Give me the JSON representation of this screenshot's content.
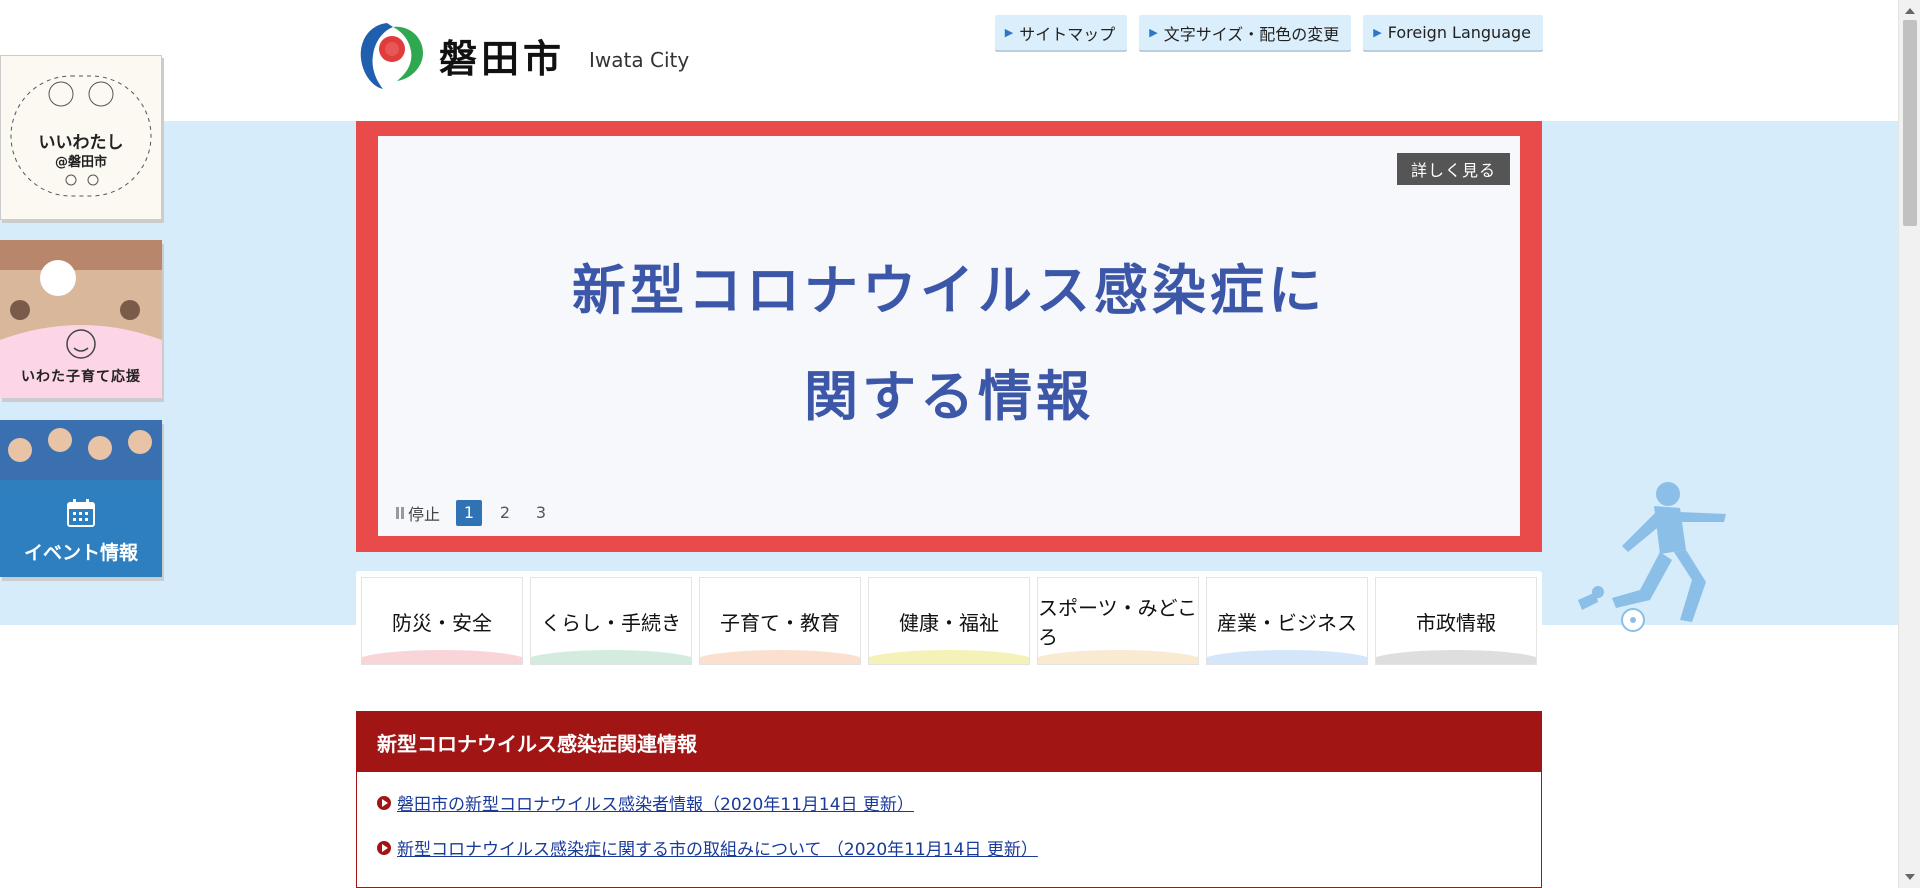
{
  "header": {
    "logo_name": "磐田市",
    "logo_en": "Iwata City",
    "top_links": [
      "サイトマップ",
      "文字サイズ・配色の変更",
      "Foreign Language"
    ]
  },
  "side_banners": [
    {
      "line1": "いいわたし",
      "line2": "@磐田市"
    },
    {
      "line1": "いわた子育て応援"
    },
    {
      "line1": "イベント情報"
    }
  ],
  "slider": {
    "detail_label": "詳しく見る",
    "title_line1": "新型コロナウイルス感染症に",
    "title_line2": "関する情報",
    "pause_label": "停止",
    "pages": [
      "1",
      "2",
      "3"
    ],
    "active_page": "1"
  },
  "categories": [
    "防災・安全",
    "くらし・手続き",
    "子育て・教育",
    "健康・福祉",
    "スポーツ・みどころ",
    "産業・ビジネス",
    "市政情報"
  ],
  "corona": {
    "heading": "新型コロナウイルス感染症関連情報",
    "links": [
      "磐田市の新型コロナウイルス感染者情報（2020年11月14日 更新）",
      "新型コロナウイルス感染症に関する市の取組みについて （2020年11月14日 更新）"
    ]
  },
  "colors": {
    "band": "#d6ecfb",
    "slider_frame": "#e94a4a",
    "slide_text": "#3c56a8",
    "corona_head": "#a21515",
    "category_accents": [
      "#f9d4d8",
      "#d3ecdf",
      "#fbe0cf",
      "#f5f2b7",
      "#faead2",
      "#d3e6fa",
      "#dedede"
    ]
  },
  "icons": [
    "iwata-logo-icon",
    "calendar-icon",
    "soccer-player-icon",
    "pause-icon"
  ]
}
